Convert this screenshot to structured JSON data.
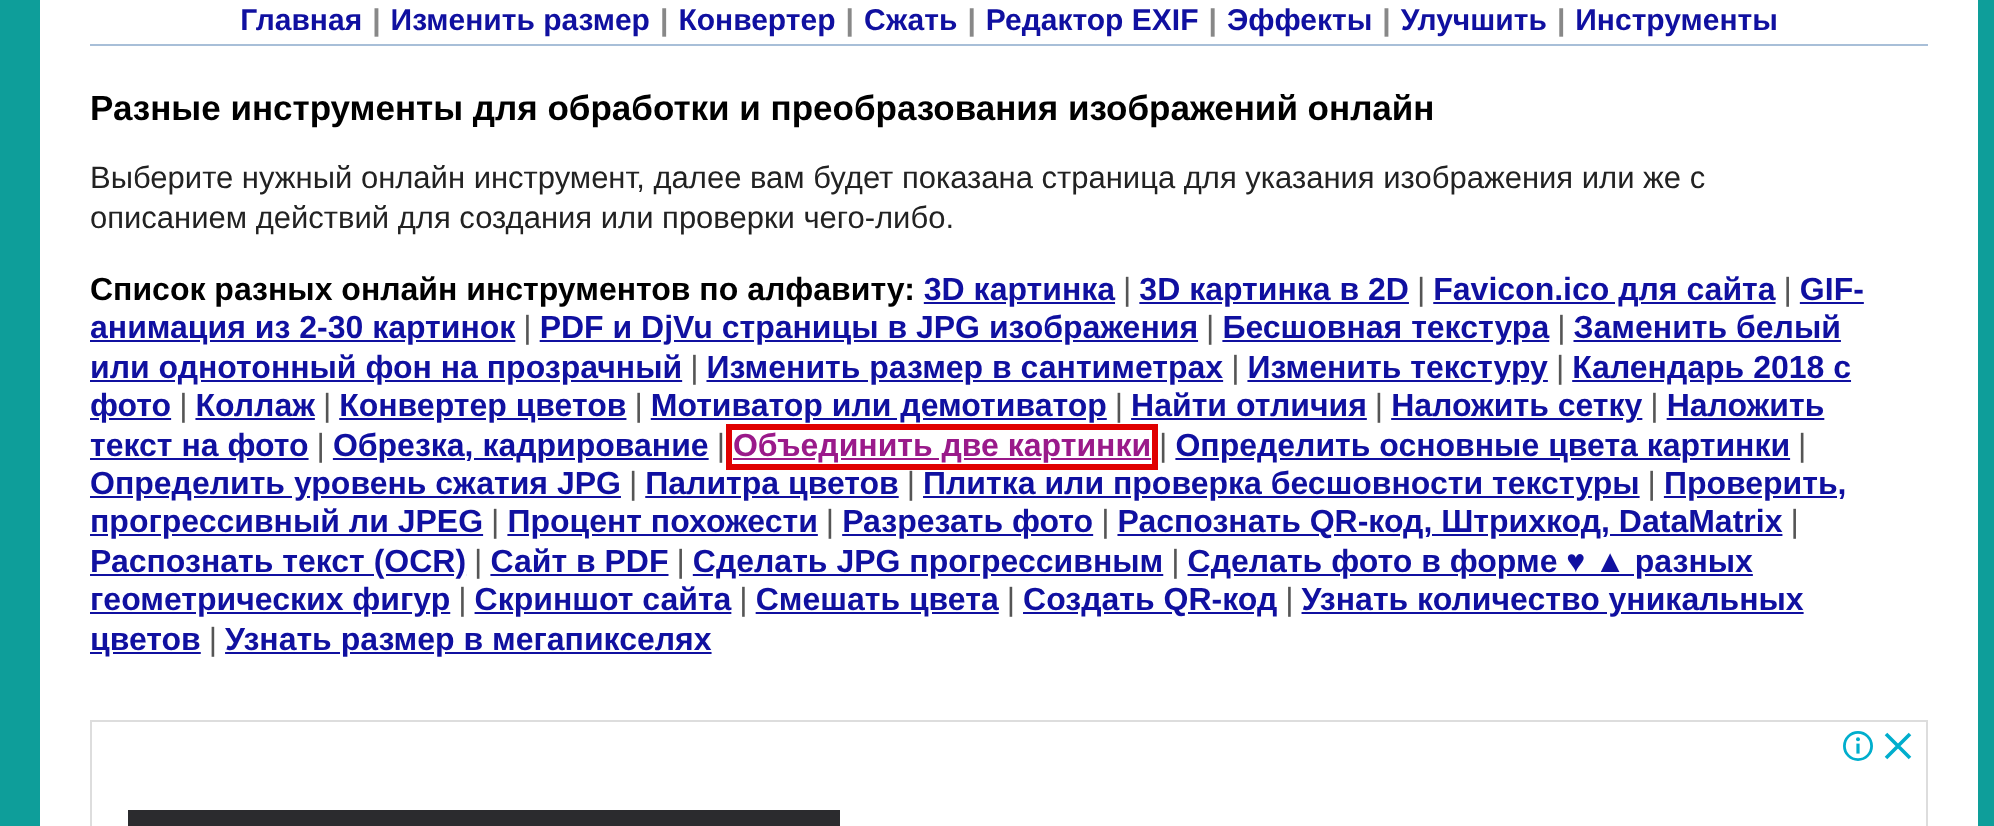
{
  "nav": [
    "Главная",
    "Изменить размер",
    "Конвертер",
    "Сжать",
    "Редактор EXIF",
    "Эффекты",
    "Улучшить",
    "Инструменты"
  ],
  "heading": "Разные инструменты для обработки и преобразования изображений онлайн",
  "intro": "Выберите нужный онлайн инструмент, далее вам будет показана страница для указания изображения или же с описанием действий для создания или проверки чего-либо.",
  "list": {
    "label": "Список разных онлайн инструментов по алфавиту:",
    "links": [
      {
        "parts": [
          "3D картинка"
        ],
        "highlighted": false
      },
      {
        "parts": [
          "3D картинка в 2D"
        ],
        "highlighted": false
      },
      {
        "parts": [
          "Favicon.ico для сайта"
        ],
        "highlighted": false
      },
      {
        "parts": [
          "GIF-",
          "анимация из 2-30 картинок"
        ],
        "highlighted": false
      },
      {
        "parts": [
          "PDF и DjVu страницы в JPG изображения"
        ],
        "highlighted": false
      },
      {
        "parts": [
          "Бесшовная текстура"
        ],
        "highlighted": false
      },
      {
        "parts": [
          "Заменить белый",
          "или однотонный фон на прозрачный"
        ],
        "highlighted": false
      },
      {
        "parts": [
          "Изменить размер в сантиметрах"
        ],
        "highlighted": false
      },
      {
        "parts": [
          "Изменить текстуру"
        ],
        "highlighted": false
      },
      {
        "parts": [
          "Календарь 2018 с",
          "фото"
        ],
        "highlighted": false
      },
      {
        "parts": [
          "Коллаж"
        ],
        "highlighted": false
      },
      {
        "parts": [
          "Конвертер цветов"
        ],
        "highlighted": false
      },
      {
        "parts": [
          "Мотиватор или демотиватор"
        ],
        "highlighted": false
      },
      {
        "parts": [
          "Найти отличия"
        ],
        "highlighted": false
      },
      {
        "parts": [
          "Наложить сетку"
        ],
        "highlighted": false
      },
      {
        "parts": [
          "Наложить",
          "текст на фото"
        ],
        "highlighted": false
      },
      {
        "parts": [
          "Обрезка, кадрирование"
        ],
        "highlighted": false
      },
      {
        "parts": [
          "Объединить две картинки"
        ],
        "highlighted": true
      },
      {
        "parts": [
          "Определить основные цвета картинки"
        ],
        "highlighted": false
      },
      {
        "parts": [
          "Определить уровень сжатия JPG"
        ],
        "highlighted": false
      },
      {
        "parts": [
          "Палитра цветов"
        ],
        "highlighted": false
      },
      {
        "parts": [
          "Плитка или проверка бесшовности текстуры"
        ],
        "highlighted": false
      },
      {
        "parts": [
          "Проверить,",
          "прогрессивный ли JPEG"
        ],
        "highlighted": false
      },
      {
        "parts": [
          "Процент похожести"
        ],
        "highlighted": false
      },
      {
        "parts": [
          "Разрезать фото"
        ],
        "highlighted": false
      },
      {
        "parts": [
          "Распознать QR-код, Штрихкод, DataMatrix"
        ],
        "highlighted": false
      },
      {
        "parts": [
          "Распознать текст (OCR)"
        ],
        "highlighted": false
      },
      {
        "parts": [
          "Сайт в PDF"
        ],
        "highlighted": false
      },
      {
        "parts": [
          "Сделать JPG прогрессивным"
        ],
        "highlighted": false
      },
      {
        "parts": [
          "Сделать фото в форме ♥ ▲ разных",
          "геометрических фигур"
        ],
        "highlighted": false
      },
      {
        "parts": [
          "Скриншот сайта"
        ],
        "highlighted": false
      },
      {
        "parts": [
          "Смешать цвета"
        ],
        "highlighted": false
      },
      {
        "parts": [
          "Создать QR-код"
        ],
        "highlighted": false
      },
      {
        "parts": [
          "Узнать количество уникальных",
          "цветов"
        ],
        "highlighted": false
      },
      {
        "parts": [
          "Узнать размер в мегапикселях"
        ],
        "highlighted": false
      }
    ]
  },
  "separator": "|"
}
